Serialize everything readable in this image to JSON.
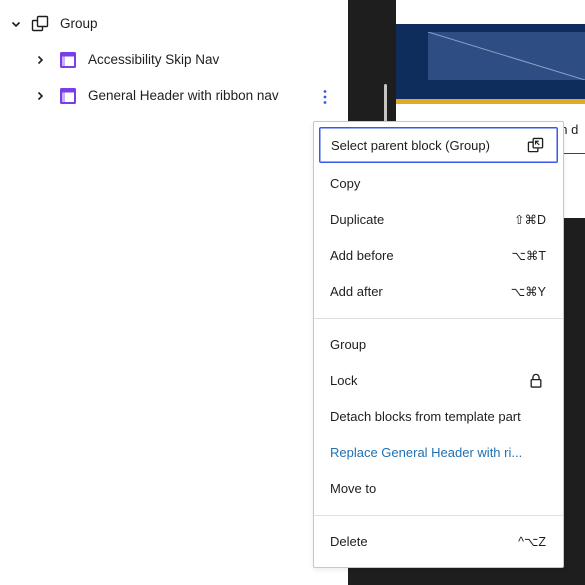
{
  "list_view": {
    "group_label": "Group",
    "items": [
      {
        "label": "Accessibility Skip Nav"
      },
      {
        "label": "General Header with ribbon nav"
      }
    ]
  },
  "canvas": {
    "peek_text": "en d"
  },
  "menu": {
    "section1": [
      {
        "label": "Select parent block (Group)",
        "icon": "select-parent-icon"
      },
      {
        "label": "Copy"
      },
      {
        "label": "Duplicate",
        "shortcut": "⇧⌘D"
      },
      {
        "label": "Add before",
        "shortcut": "⌥⌘T"
      },
      {
        "label": "Add after",
        "shortcut": "⌥⌘Y"
      }
    ],
    "section2": [
      {
        "label": "Group"
      },
      {
        "label": "Lock",
        "icon": "lock-icon"
      },
      {
        "label": "Detach blocks from template part"
      },
      {
        "label": "Replace General Header with ri..."
      },
      {
        "label": "Move to"
      }
    ],
    "section3": [
      {
        "label": "Delete",
        "shortcut": "^⌥Z"
      }
    ]
  },
  "colors": {
    "accent_blue": "#3858e9",
    "link_blue": "#2271b1",
    "template_part_purple": "#7a3ee8",
    "header_navy": "#0f2d5c",
    "header_gold": "#e2a928"
  }
}
